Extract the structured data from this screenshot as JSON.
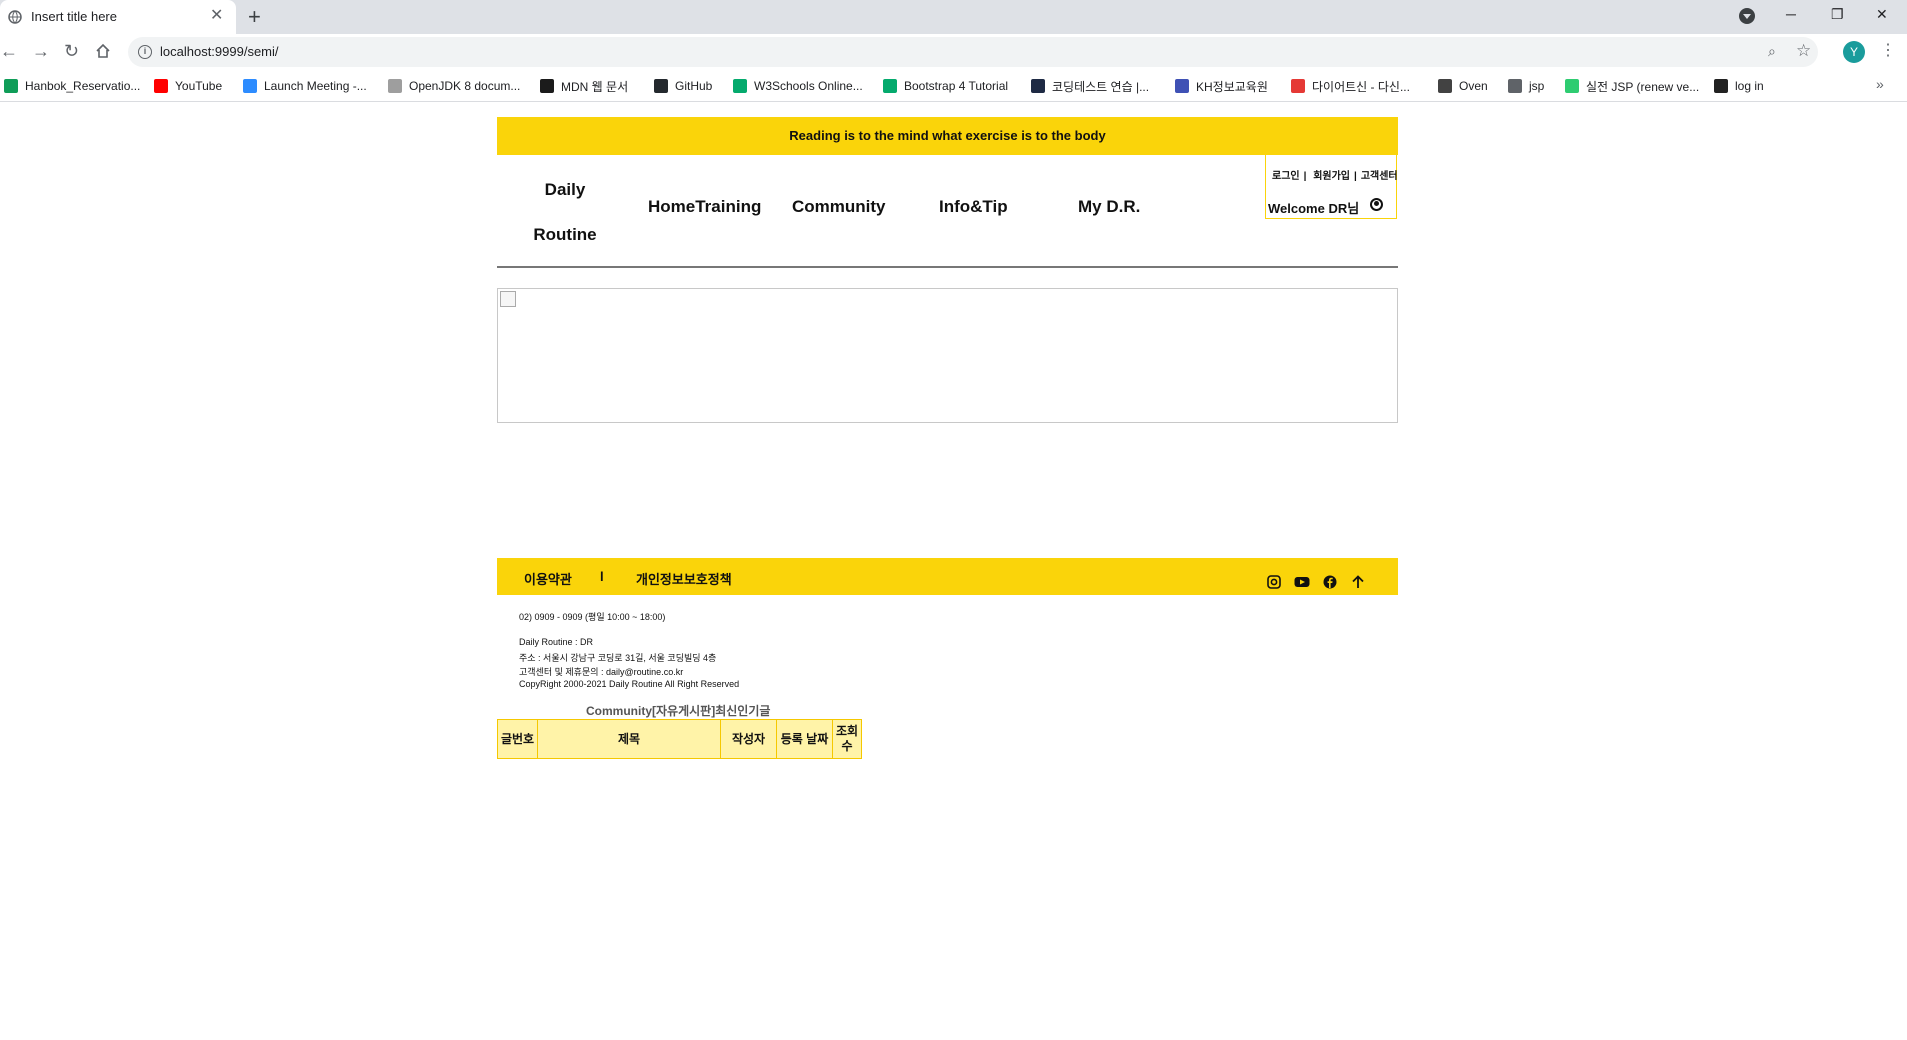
{
  "browser": {
    "tab_title": "Insert title here",
    "tab_close": "✕",
    "new_tab": "+",
    "url": "localhost:9999/semi/",
    "avatar_letter": "Y",
    "bookmarks": [
      {
        "label": "Hanbok_Reservatio...",
        "icon_color": "#0f9d58"
      },
      {
        "label": "YouTube",
        "icon_color": "#ff0000"
      },
      {
        "label": "Launch Meeting -...",
        "icon_color": "#2d8cff"
      },
      {
        "label": "OpenJDK 8 docum...",
        "icon_color": "#9e9e9e"
      },
      {
        "label": "MDN 웹 문서",
        "icon_color": "#1b1b1b"
      },
      {
        "label": "GitHub",
        "icon_color": "#24292e"
      },
      {
        "label": "W3Schools Online...",
        "icon_color": "#04aa6d"
      },
      {
        "label": "Bootstrap 4 Tutorial",
        "icon_color": "#04aa6d"
      },
      {
        "label": "코딩테스트 연습 |...",
        "icon_color": "#1e2a44"
      },
      {
        "label": "KH정보교육원",
        "icon_color": "#3f51b5"
      },
      {
        "label": "다이어트신 - 다신...",
        "icon_color": "#e53935"
      },
      {
        "label": "Oven",
        "icon_color": "#424242"
      },
      {
        "label": "jsp",
        "icon_color": "#5f6368"
      },
      {
        "label": "실전 JSP (renew ve...",
        "icon_color": "#2ecc71"
      },
      {
        "label": "log in",
        "icon_color": "#222222"
      }
    ],
    "bookmarks_more": "»"
  },
  "page": {
    "quote": "Reading is to the mind what exercise is to the body",
    "logo_line1": "Daily",
    "logo_line2": "Routine",
    "menu": [
      "HomeTraining",
      "Community",
      "Info&Tip",
      "My D.R."
    ],
    "user_links": [
      "로그인",
      "회원가입",
      "고객센터"
    ],
    "welcome": "Welcome DR님",
    "footer_links": [
      "이용약관",
      "개인정보보호정책"
    ],
    "footer_divider": "l",
    "footer_info": [
      "02) 0909 - 0909 (평일 10:00 ~ 18:00)",
      "Daily Routine : DR",
      "주소 : 서울시 강남구 코딩로 31길, 서울 코딩빌딩 4층",
      "고객센터 및 제휴문의 : daily@routine.co.kr",
      "CopyRight 2000-2021 Daily Routine All Right Reserved"
    ],
    "board_title": "Community[자유게시판]최신인기글",
    "board_headers": [
      "글번호",
      "제목",
      "작성자",
      "등록 날짜",
      "조회수"
    ]
  },
  "colors": {
    "brand_yellow": "#fad40a",
    "table_header_bg": "#fff3a8"
  }
}
